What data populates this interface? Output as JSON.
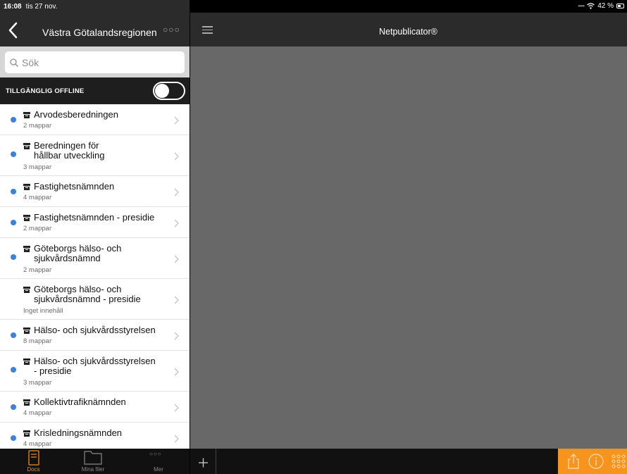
{
  "status": {
    "time": "16:08",
    "date": "tis 27 nov.",
    "battery": "42 %"
  },
  "left": {
    "title": "Västra Götalandsregionen",
    "search_placeholder": "Sök",
    "offline_label": "TILLGÄNGLIG OFFLINE",
    "offline_enabled": false
  },
  "items": [
    {
      "lines": [
        "Arvodesberedningen"
      ],
      "sub": "2 mappar",
      "dot": true
    },
    {
      "lines": [
        "Beredningen för",
        "hållbar utveckling"
      ],
      "sub": "3 mappar",
      "dot": true
    },
    {
      "lines": [
        "Fastighetsnämnden"
      ],
      "sub": "4 mappar",
      "dot": true
    },
    {
      "lines": [
        "Fastighetsnämnden - presidie"
      ],
      "sub": "2 mappar",
      "dot": true
    },
    {
      "lines": [
        "Göteborgs hälso- och",
        "sjukvårdsnämnd"
      ],
      "sub": "2 mappar",
      "dot": true
    },
    {
      "lines": [
        "Göteborgs hälso- och",
        "sjukvårdsnämnd - presidie"
      ],
      "sub": "Inget innehåll",
      "dot": false
    },
    {
      "lines": [
        "Hälso- och sjukvårdsstyrelsen"
      ],
      "sub": "8 mappar",
      "dot": true
    },
    {
      "lines": [
        "Hälso- och sjukvårdsstyrelsen",
        "- presidie"
      ],
      "sub": "3 mappar",
      "dot": true
    },
    {
      "lines": [
        "Kollektivtrafiknämnden"
      ],
      "sub": "4 mappar",
      "dot": true
    },
    {
      "lines": [
        "Krisledningsnämnden"
      ],
      "sub": "4 mappar",
      "dot": true
    }
  ],
  "tabs": [
    {
      "label": "Docs",
      "icon": "docs-icon",
      "active": true
    },
    {
      "label": "Mina filer",
      "icon": "folder-icon",
      "active": false
    },
    {
      "label": "Mer",
      "icon": "more-icon",
      "active": false
    }
  ],
  "right": {
    "title": "Netpublicator®"
  },
  "colors": {
    "accent": "#f7941d",
    "dot": "#3d82d8",
    "header": "#2b2b2b",
    "content": "#686868"
  }
}
